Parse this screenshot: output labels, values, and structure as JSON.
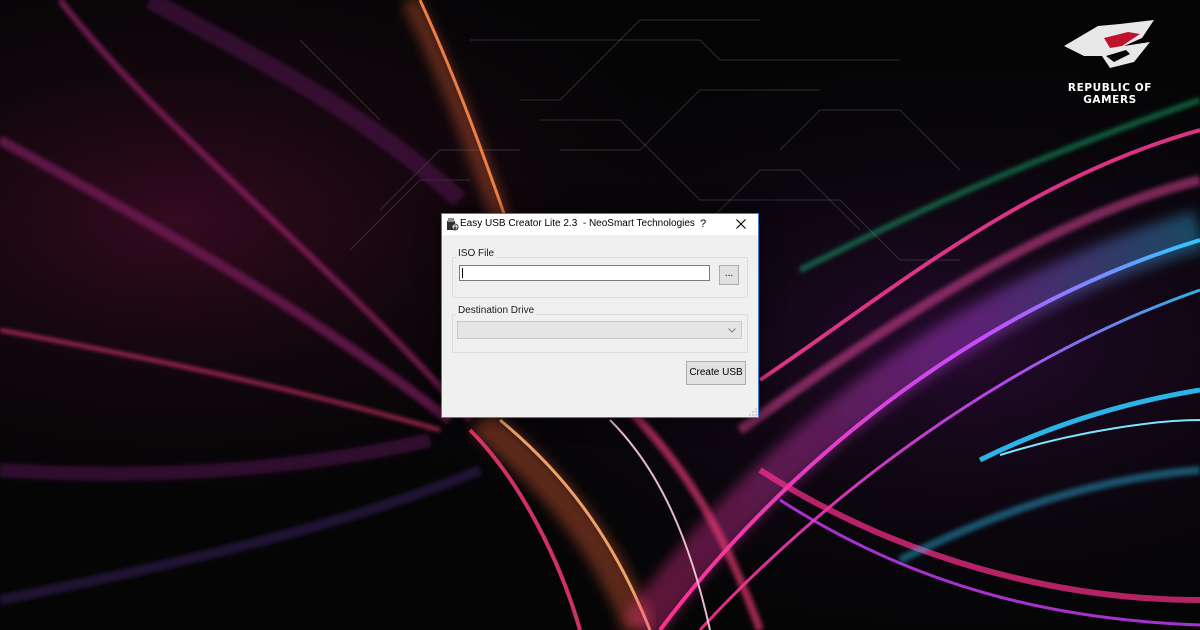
{
  "wallpaper": {
    "brand_line1": "REPUBLIC OF",
    "brand_line2": "GAMERS"
  },
  "window": {
    "title": "Easy USB Creator Lite 2.3  - NeoSmart Technologies",
    "help_label": "?",
    "iso_group_label": "ISO File",
    "iso_input_value": "",
    "browse_label": "...",
    "dest_group_label": "Destination Drive",
    "dest_selected": "",
    "create_label": "Create USB"
  },
  "colors": {
    "window_border": "#3b7dd8",
    "window_bg": "#f0f0f0",
    "accent_pink": "#ff2a7a",
    "accent_cyan": "#2ec8ff"
  }
}
